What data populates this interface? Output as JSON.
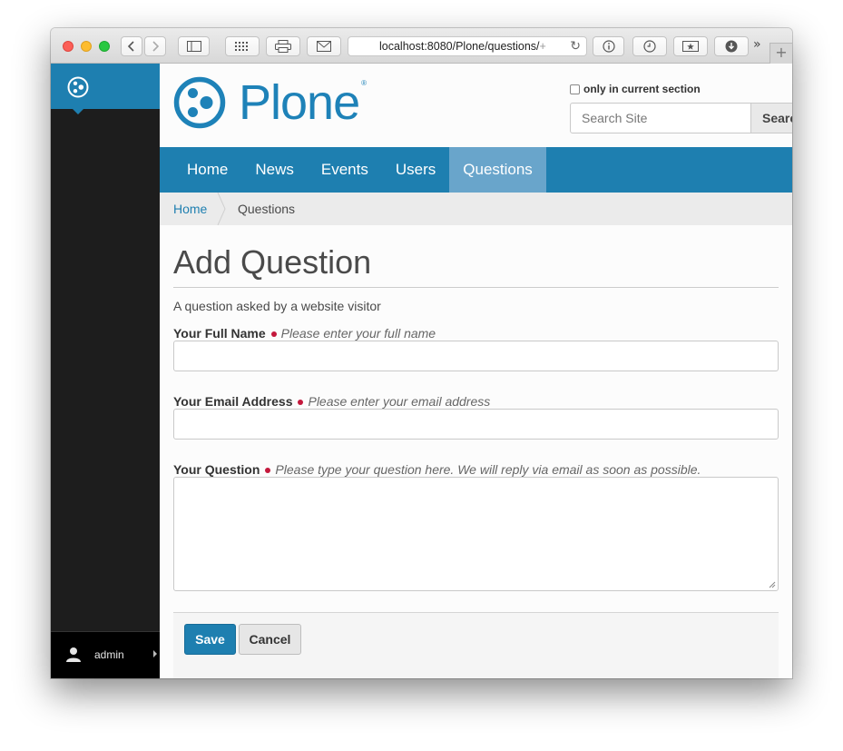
{
  "browser": {
    "url_host": "localhost:8080",
    "url_path": "/Plone/questions/",
    "url_tail": "+",
    "reload_glyph": "↻",
    "more_glyph": "»",
    "newtab_glyph": "+"
  },
  "sidebar": {
    "user_name": "admin"
  },
  "header": {
    "logo_text": "Plone",
    "logo_reg": "®",
    "search_checkbox_label": "only in current section",
    "search_placeholder": "Search Site",
    "search_button_label": "Search"
  },
  "nav": {
    "items": [
      {
        "label": "Home"
      },
      {
        "label": "News"
      },
      {
        "label": "Events"
      },
      {
        "label": "Users"
      },
      {
        "label": "Questions"
      }
    ],
    "active_index": 4
  },
  "breadcrumbs": {
    "home": "Home",
    "current": "Questions"
  },
  "form": {
    "title": "Add Question",
    "description": "A question asked by a website visitor",
    "fields": [
      {
        "label": "Your Full Name",
        "help": "Please enter your full name",
        "value": ""
      },
      {
        "label": "Your Email Address",
        "help": "Please enter your email address",
        "value": ""
      },
      {
        "label": "Your Question",
        "help": "Please type your question here. We will reply via email as soon as possible.",
        "value": ""
      }
    ],
    "save_label": "Save",
    "cancel_label": "Cancel"
  },
  "colors": {
    "brand": "#1e7fb0",
    "nav_active": "#69a5cb",
    "required": "#c4183c",
    "sidebar": "#1d1d1d"
  }
}
